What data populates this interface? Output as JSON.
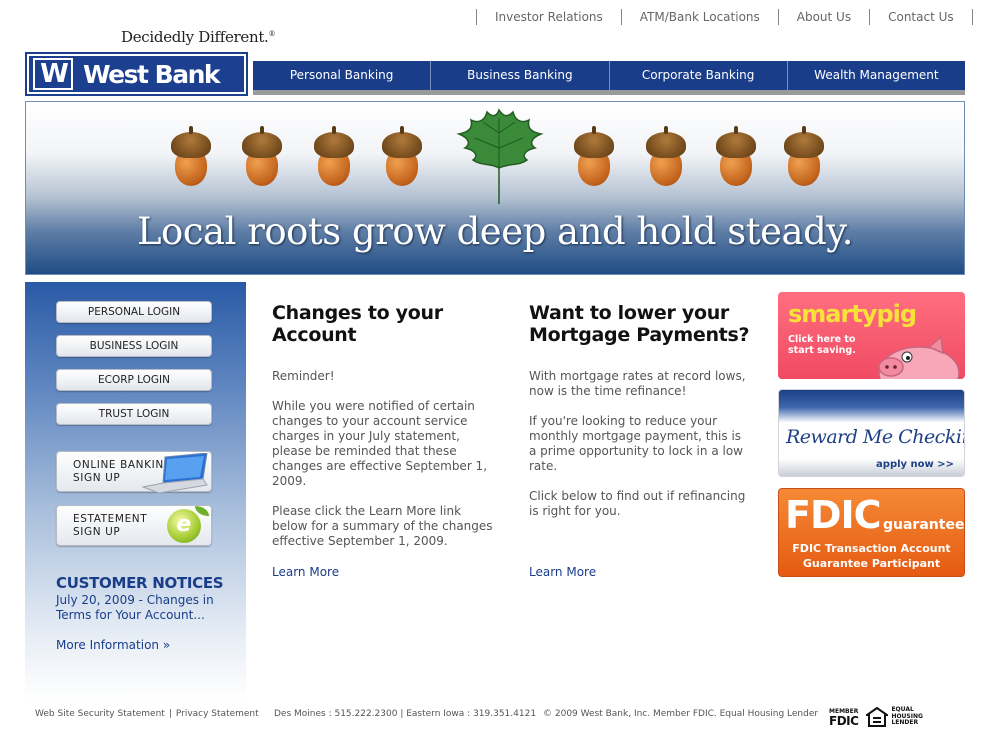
{
  "utility_nav": [
    "Investor Relations",
    "ATM/Bank Locations",
    "About Us",
    "Contact Us"
  ],
  "logo": {
    "tagline": "Decidedly Different.",
    "tagline_mark": "®",
    "w_mark": "W",
    "name": "West Bank"
  },
  "main_nav": [
    "Personal Banking",
    "Business Banking",
    "Corporate Banking",
    "Wealth Management"
  ],
  "hero": {
    "headline": "Local roots grow deep and hold steady."
  },
  "sidebar": {
    "logins": [
      "PERSONAL LOGIN",
      "BUSINESS LOGIN",
      "ECORP LOGIN",
      "TRUST LOGIN"
    ],
    "online_banking": {
      "line1": "ONLINE BANKING",
      "line2": "SIGN UP"
    },
    "estatement": {
      "line1": "ESTATEMENT",
      "line2": "SIGN UP",
      "icon_letter": "e"
    },
    "customer_notices": {
      "title": "CUSTOMER NOTICES",
      "text": "July 20, 2009 - Changes in Terms for Your Account...",
      "more": "More Information »"
    }
  },
  "col_changes": {
    "title": "Changes to your Account",
    "paragraphs": [
      "Reminder!",
      "While you were notified of  certain changes  to your account service charges in  your July statement, please be  reminded   that these changes  are  effective September 1, 2009.",
      "Please click the Learn More link below for a summary of the changes effective September 1, 2009."
    ],
    "link": "Learn More"
  },
  "col_mortgage": {
    "title": "Want to lower your Mortgage Payments?",
    "paragraphs": [
      "With mortgage rates at record lows, now is the time refinance!",
      "If you're looking to reduce your monthly mortgage payment, this is a prime opportunity to lock in a low rate.",
      "Click below to find out if refinancing is right for you."
    ],
    "link": "Learn More"
  },
  "promos": {
    "smartypig": {
      "title": "smartypig",
      "subtitle": "Click here to start saving."
    },
    "reward": {
      "title": "Reward Me Checking",
      "apply": "apply now >>"
    },
    "fdic": {
      "title": "FDIC",
      "guarantee": "guarantee",
      "line1": "FDIC Transaction Account",
      "line2": "Guarantee Participant"
    }
  },
  "footer": {
    "security": "Web Site Security Statement",
    "privacy": "Privacy Statement",
    "contact": "Des Moines : 515.222.2300 | Eastern Iowa : 319.351.4121",
    "copyright": "© 2009 West Bank, Inc. Member FDIC. Equal Housing Lender",
    "member_fdic_top": "MEMBER",
    "member_fdic": "FDIC",
    "ehl_lines": [
      "EQUAL",
      "HOUSING",
      "LENDER"
    ]
  },
  "colors": {
    "brand_blue": "#1a3d8a",
    "fdic_orange": "#e55a12",
    "smartypig_pink": "#f04a63"
  }
}
